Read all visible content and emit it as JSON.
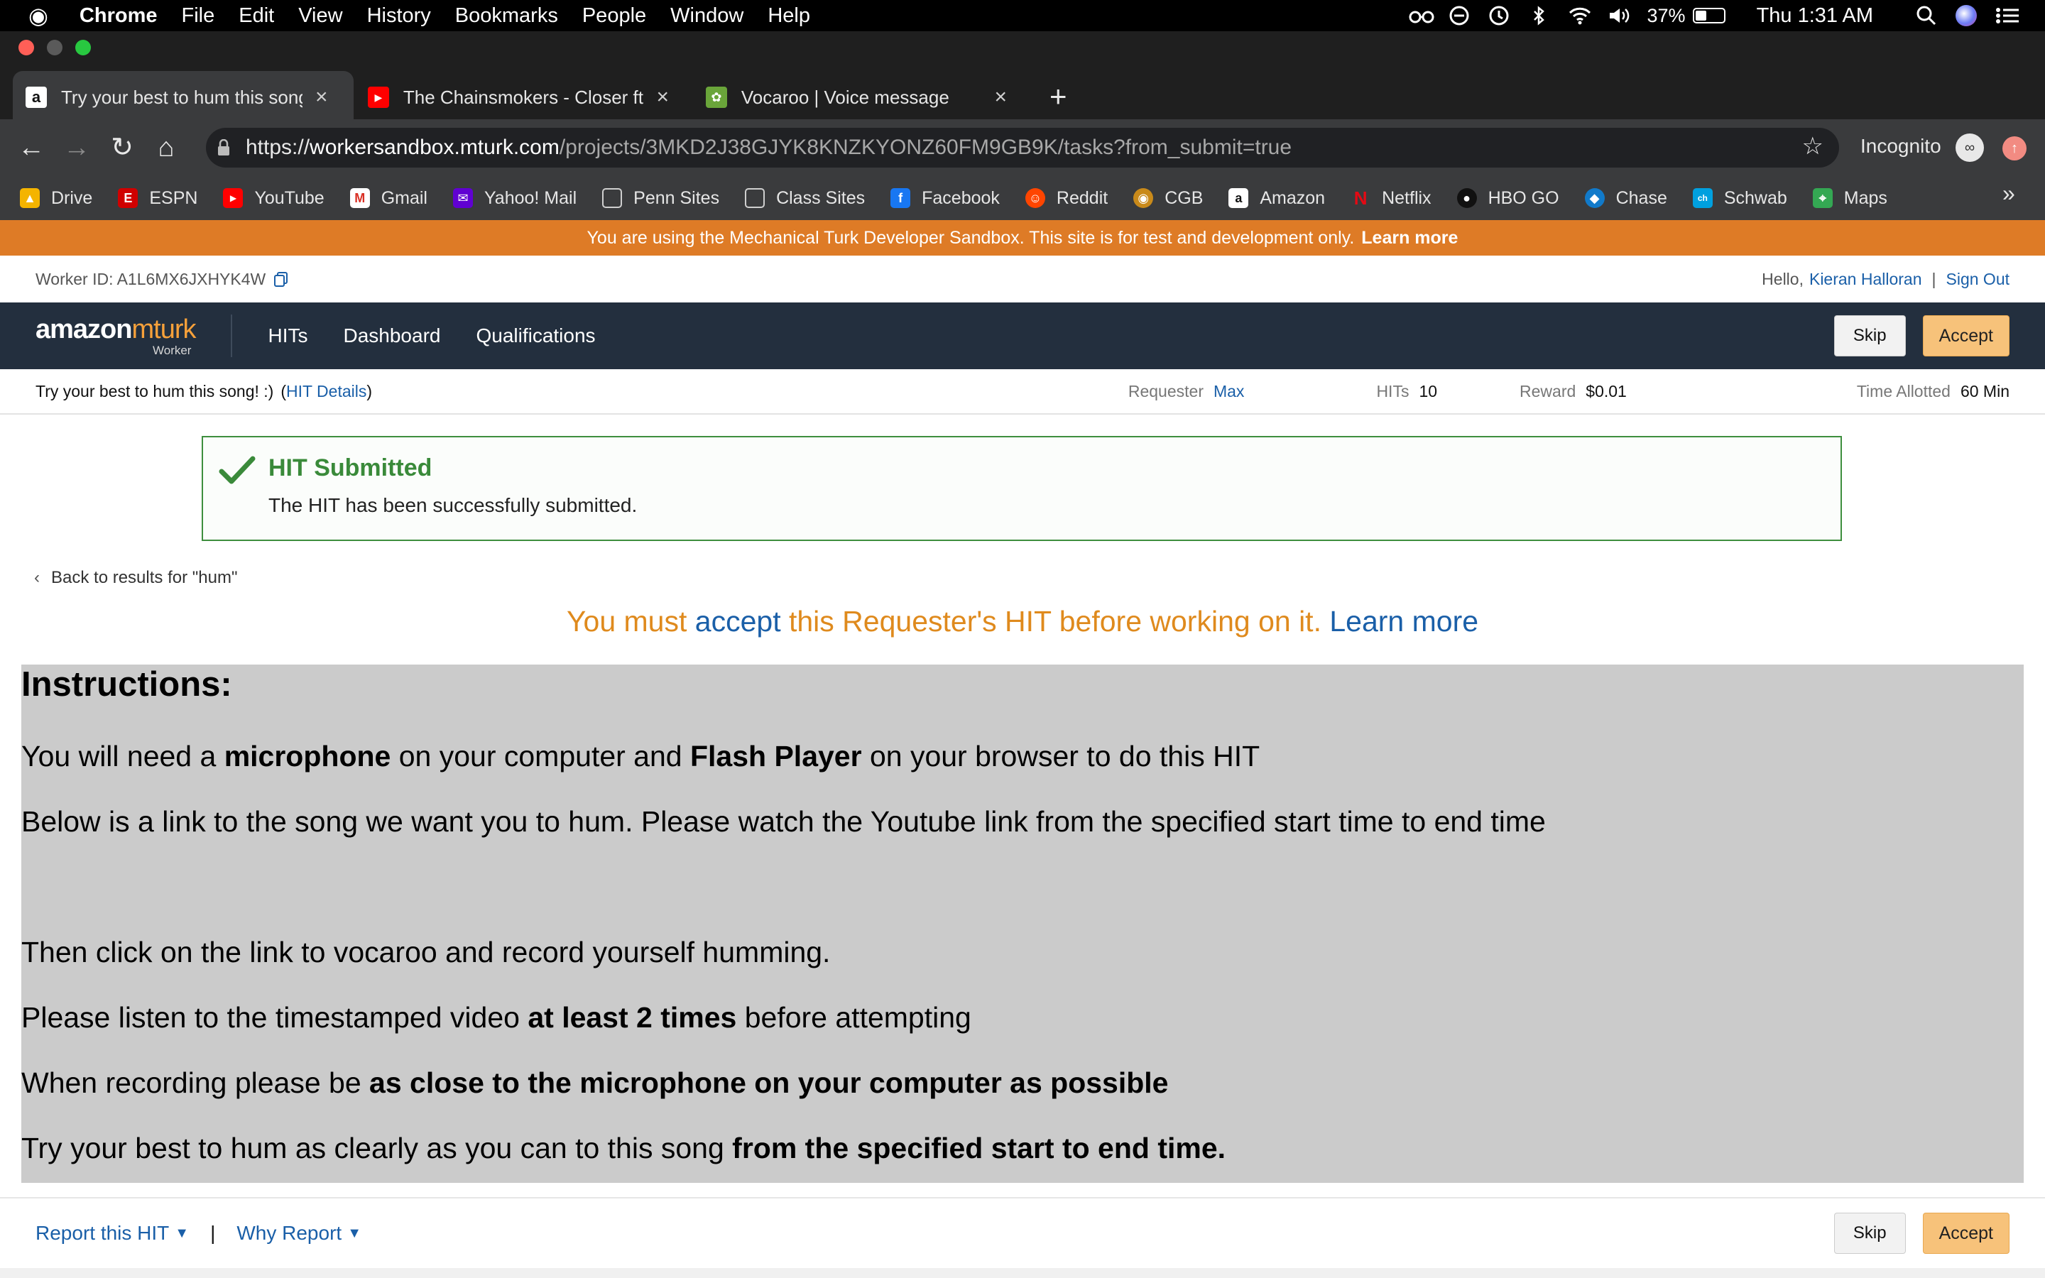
{
  "menubar": {
    "app": "Chrome",
    "items": [
      "File",
      "Edit",
      "View",
      "History",
      "Bookmarks",
      "People",
      "Window",
      "Help"
    ],
    "battery": "37%",
    "clock": "Thu 1:31 AM"
  },
  "tabs": [
    {
      "label": "Try your best to hum this song! :)",
      "icon": "amazon-icon",
      "active": true
    },
    {
      "label": "The Chainsmokers - Closer ft. Halsey",
      "icon": "youtube-icon",
      "active": false
    },
    {
      "label": "Vocaroo | Voice message",
      "icon": "vocaroo-icon",
      "active": false
    }
  ],
  "omnibox": {
    "scheme": "https://",
    "host": "workersandbox.mturk.com",
    "path": "/projects/3MKD2J38GJYK8KNZKYONZ60FM9GB9K/tasks?from_submit=true"
  },
  "profile": {
    "label": "Incognito"
  },
  "bookmarks": [
    {
      "label": "Drive",
      "color": "#f4b400"
    },
    {
      "label": "ESPN",
      "color": "#d00000"
    },
    {
      "label": "YouTube",
      "color": "#ff0000"
    },
    {
      "label": "Gmail",
      "color": "#d93025"
    },
    {
      "label": "Yahoo! Mail",
      "color": "#6001d2"
    },
    {
      "label": "Penn Sites",
      "color": "#9aa0a6"
    },
    {
      "label": "Class Sites",
      "color": "#9aa0a6"
    },
    {
      "label": "Facebook",
      "color": "#1877f2"
    },
    {
      "label": "Reddit",
      "color": "#ff4500"
    },
    {
      "label": "CGB",
      "color": "#c98a1a"
    },
    {
      "label": "Amazon",
      "color": "#232f3e"
    },
    {
      "label": "Netflix",
      "color": "#e50914"
    },
    {
      "label": "HBO GO",
      "color": "#444444"
    },
    {
      "label": "Chase",
      "color": "#117aca"
    },
    {
      "label": "Schwab",
      "color": "#00a0df"
    },
    {
      "label": "Maps",
      "color": "#34a853"
    }
  ],
  "bookmarks_overflow": "»",
  "sandbox_banner": {
    "text": "You are using the Mechanical Turk Developer Sandbox. This site is for test and development only.",
    "link": "Learn more"
  },
  "worker": {
    "id_label": "Worker ID: A1L6MX6JXHYK4W",
    "hello": "Hello,",
    "name": "Kieran Halloran",
    "sep": "|",
    "signout": "Sign Out"
  },
  "nav": {
    "logo_a": "amazon",
    "logo_b": "mturk",
    "logo_sub": "Worker",
    "links": [
      "HITs",
      "Dashboard",
      "Qualifications"
    ],
    "skip": "Skip",
    "accept": "Accept"
  },
  "hit": {
    "title": "Try your best to hum this song! :)",
    "details_open": "(",
    "details": "HIT Details",
    "details_close": ")",
    "requester_label": "Requester",
    "requester": "Max",
    "hits_label": "HITs",
    "hits": "10",
    "reward_label": "Reward",
    "reward": "$0.01",
    "time_label": "Time Allotted",
    "time": "60 Min"
  },
  "alert": {
    "title": "HIT Submitted",
    "message": "The HIT has been successfully submitted."
  },
  "back_link": "Back to results for \"hum\"",
  "must_accept": {
    "pre": "You must ",
    "accept": "accept",
    "post": " this Requester's HIT before working on it. ",
    "learn": "Learn more"
  },
  "instructions": {
    "heading": "Instructions:",
    "l1_a": "You will need a ",
    "l1_b": "microphone",
    "l1_c": " on your computer and ",
    "l1_d": "Flash Player",
    "l1_e": " on your browser to do this HIT",
    "l2": "Below is a link to the song we want you to hum. Please watch the Youtube link from the specified start time to end time",
    "l3": "Then click on the link to vocaroo and record yourself humming.",
    "l4_a": "Please listen to the timestamped video ",
    "l4_b": "at least 2 times",
    "l4_c": " before attempting",
    "l5_a": "When recording please be ",
    "l5_b": "as close to the microphone on your computer as possible",
    "l6_a": "Try your best to hum as clearly as you can to this song ",
    "l6_b": "from the specified start to end time."
  },
  "footer": {
    "report": "Report this HIT",
    "sep": "|",
    "why": "Why Report",
    "skip": "Skip",
    "accept": "Accept"
  }
}
